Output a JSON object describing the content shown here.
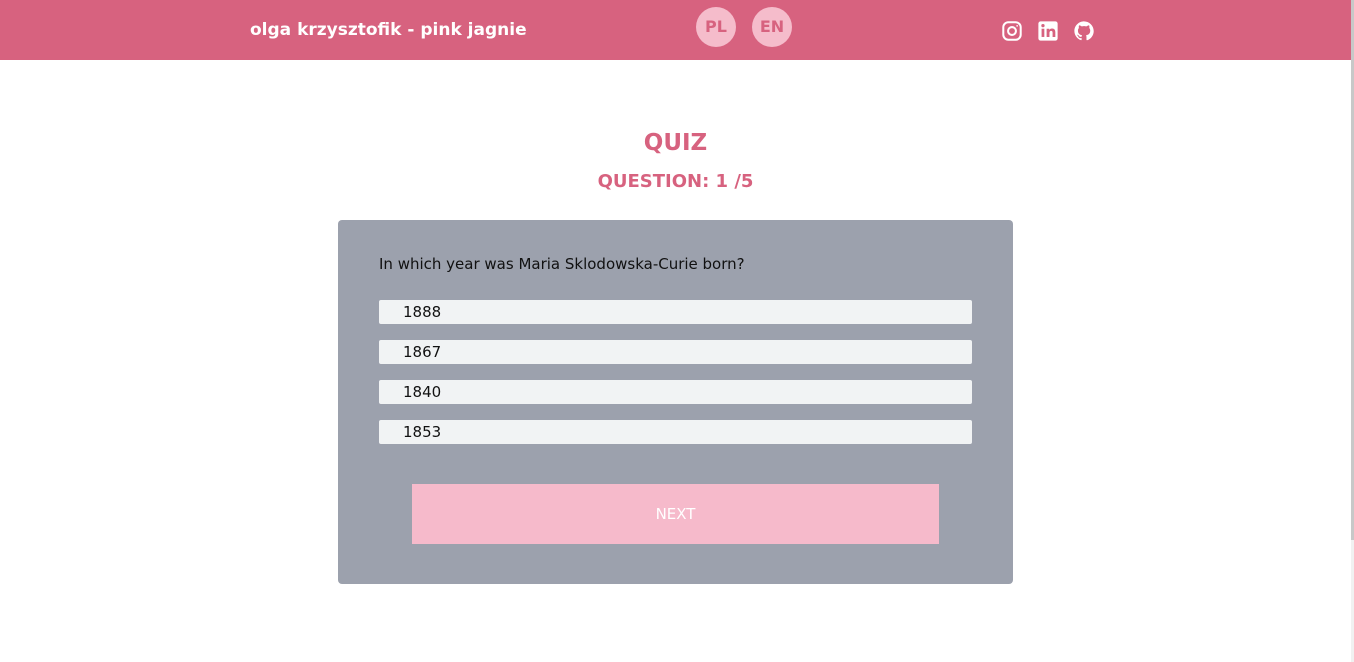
{
  "header": {
    "brand": "olga krzysztofik - pink jagnie",
    "languages": [
      "PL",
      "EN"
    ],
    "social_icons": [
      "instagram-icon",
      "linkedin-icon",
      "github-icon"
    ],
    "background_color": "#d7627f"
  },
  "quiz": {
    "title": "QUIZ",
    "counter": "QUESTION: 1 /5",
    "question": "In which year was Maria Sklodowska-Curie born?",
    "answers": [
      "1888",
      "1867",
      "1840",
      "1853"
    ],
    "next_label": "NEXT"
  },
  "colors": {
    "accent": "#d7627f",
    "card": "#9ca1ad",
    "answer_bg": "#f1f3f4",
    "button": "#f6bacb"
  }
}
